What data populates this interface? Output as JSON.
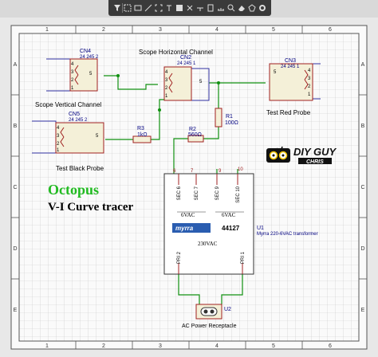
{
  "toolbar": {
    "tools": [
      "filter-icon",
      "marquee-icon",
      "rectangle-icon",
      "wire-icon",
      "fit-icon",
      "text-icon",
      "bus-icon",
      "no-connect-icon",
      "junction-icon",
      "component-icon",
      "ruler-icon",
      "zoom-icon",
      "eraser-icon",
      "polygon-icon",
      "settings-icon"
    ]
  },
  "frame": {
    "cols": [
      "1",
      "2",
      "3",
      "4",
      "5",
      "6"
    ],
    "rows": [
      "A",
      "B",
      "C",
      "D",
      "E"
    ]
  },
  "title": {
    "line1": "Octopus",
    "line2": "V-I Curve tracer"
  },
  "logo": {
    "line1": "DIY GUY",
    "line2": "CHRIS"
  },
  "connectors": {
    "cn4": {
      "ref": "CN4",
      "value": "24 245 2",
      "label": "Scope Vertical Channel",
      "pins": [
        "4",
        "3",
        "2",
        "1",
        "5"
      ]
    },
    "cn5": {
      "ref": "CN5",
      "value": "24 245 2",
      "label": "Test Black Probe",
      "pins": [
        "4",
        "3",
        "2",
        "1",
        "5"
      ]
    },
    "cn2": {
      "ref": "CN2",
      "value": "24 245 1",
      "label": "Scope Horizontal Channel",
      "pins": [
        "4",
        "3",
        "2",
        "1",
        "5"
      ]
    },
    "cn3": {
      "ref": "CN3",
      "value": "24 245 1",
      "label": "Test Red Probe",
      "pins": [
        "5",
        "4",
        "3",
        "2",
        "1"
      ]
    }
  },
  "resistors": {
    "r1": {
      "ref": "R1",
      "value": "100Ω"
    },
    "r2": {
      "ref": "R2",
      "value": "560Ω"
    },
    "r3": {
      "ref": "R3",
      "value": "1kΩ"
    }
  },
  "transformer": {
    "ref": "U1",
    "desc": "Myrra 220-6VAC transformer",
    "sec6": "SEC 6",
    "sec7": "SEC 7",
    "sec9": "SEC 9",
    "sec10": "SEC 10",
    "pin6": "6",
    "pin7": "7",
    "pin9": "9",
    "pin10": "10",
    "vac_left": "6VAC",
    "vac_right": "6VAC",
    "brand": "myrra",
    "part": "44127",
    "primary": "230VAC",
    "pri2": "PRI 2",
    "pri1": "PRI 1"
  },
  "receptacle": {
    "ref": "U2",
    "label": "AC Power Receptacle"
  }
}
